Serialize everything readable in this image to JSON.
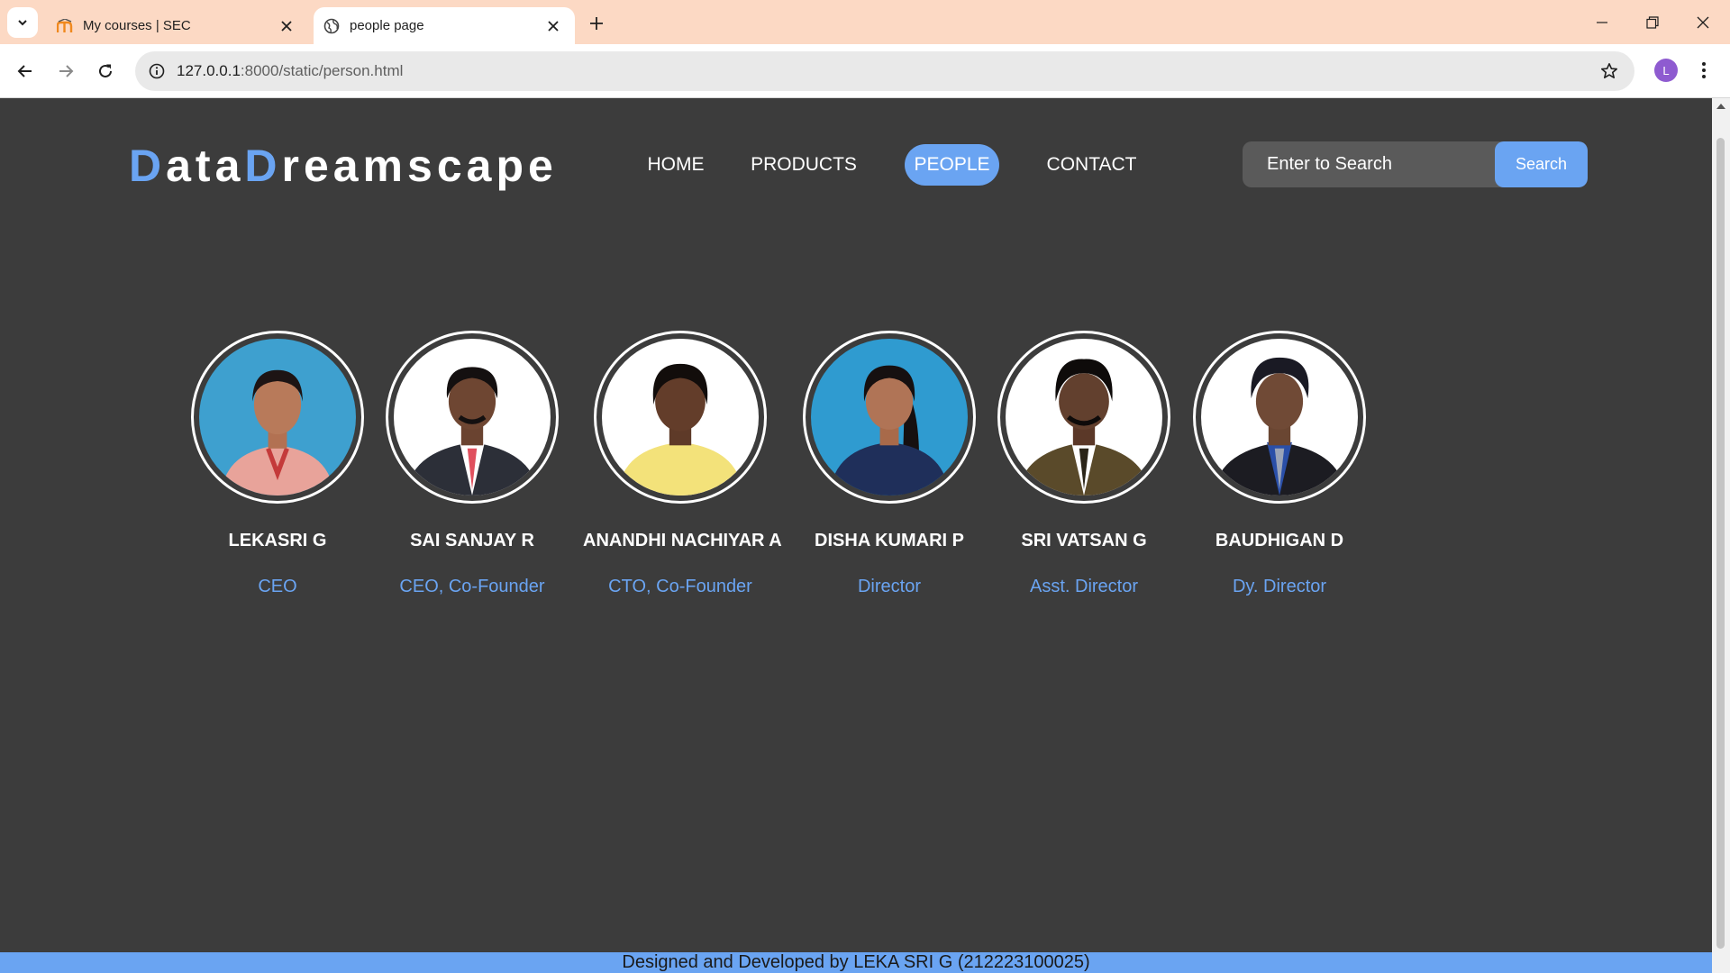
{
  "browser": {
    "tabs": [
      {
        "title": "My courses | SEC",
        "favicon": "moodle-icon"
      },
      {
        "title": "people page",
        "favicon": "globe-icon"
      }
    ],
    "url_host": "127.0.0.1",
    "url_rest": ":8000/static/person.html",
    "profile_initial": "L"
  },
  "site": {
    "logo_part1_accent": "D",
    "logo_part1": "ata",
    "logo_part2_accent": "D",
    "logo_part2": "reamscape",
    "nav": [
      {
        "label": "HOME"
      },
      {
        "label": "PRODUCTS"
      },
      {
        "label": "PEOPLE",
        "active": true
      },
      {
        "label": "CONTACT"
      }
    ],
    "search_placeholder": "Enter to Search",
    "search_button": "Search",
    "accent_color": "#6aa4f2",
    "background_color": "#3c3c3c"
  },
  "people": [
    {
      "name": "LEKASRI G",
      "role": "CEO",
      "photo_bg": "#3ea0cf",
      "shirt": "#e8a39a"
    },
    {
      "name": "SAI SANJAY R",
      "role": "CEO, Co-Founder",
      "photo_bg": "#ffffff",
      "shirt": "#2c2f38"
    },
    {
      "name": "ANANDHI NACHIYAR A",
      "role": "CTO, Co-Founder",
      "photo_bg": "#ffffff",
      "shirt": "#f3e27a"
    },
    {
      "name": "DISHA KUMARI P",
      "role": "Director",
      "photo_bg": "#2f9bd0",
      "shirt": "#1f2f5a"
    },
    {
      "name": "SRI VATSAN G",
      "role": "Asst. Director",
      "photo_bg": "#ffffff",
      "shirt": "#5a4a2a"
    },
    {
      "name": "BAUDHIGAN D",
      "role": "Dy. Director",
      "photo_bg": "#ffffff",
      "shirt": "#1c1c22"
    }
  ],
  "footer": {
    "text": "Designed and Developed by LEKA SRI G (212223100025)"
  }
}
